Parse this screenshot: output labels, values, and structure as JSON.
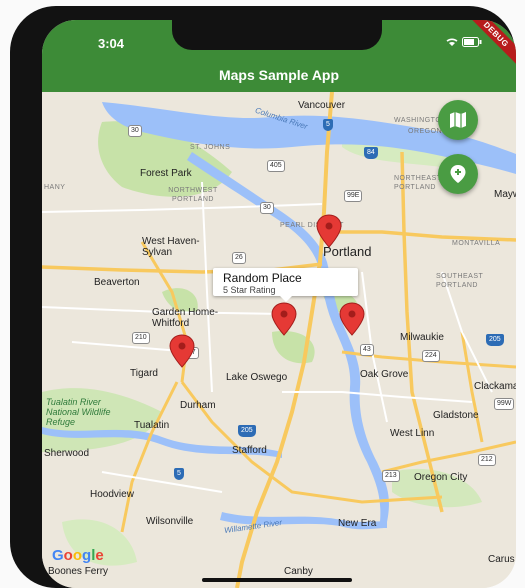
{
  "status_bar": {
    "time": "3:04",
    "icons": "wifi-battery",
    "debug_banner": "DEBUG"
  },
  "app_bar": {
    "title": "Maps Sample App"
  },
  "map": {
    "cities": [
      "Vancouver",
      "Portland",
      "Forest Park",
      "West Haven-Sylvan",
      "Beaverton",
      "Garden Home-Whitford",
      "Tigard",
      "Lake Oswego",
      "Oak Grove",
      "Milwaukie",
      "Durham",
      "Tualatin",
      "Stafford",
      "West Linn",
      "Gladstone",
      "Oregon City",
      "Hoodview",
      "Wilsonville",
      "New Era",
      "Canby",
      "Clackamas",
      "Maywood Park",
      "Carus",
      "Sherwood",
      "Boones Ferry"
    ],
    "districts": [
      "ST. JOHNS",
      "NORTHWEST PORTLAND",
      "PEARL DISTRICT",
      "NORTHEAST PORTLAND",
      "SOUTHEAST PORTLAND",
      "MONTAVILLA",
      "WASHINGTON",
      "OREGON",
      "HANY"
    ],
    "water_labels": [
      "Columbia River",
      "Willamette River"
    ],
    "green_labels": [
      "Tualatin River National Wildlife Refuge"
    ],
    "highway_shields": [
      "30",
      "5",
      "405",
      "30",
      "26",
      "84",
      "205",
      "217",
      "210",
      "99E",
      "224",
      "43",
      "212",
      "213",
      "205",
      "5",
      "99W"
    ],
    "attribution": "Google",
    "info_window": {
      "title": "Random Place",
      "snippet": "5 Star Rating"
    },
    "markers": [
      "marker-pearl-district",
      "marker-portland-south",
      "marker-milwaukie",
      "marker-tigard"
    ]
  },
  "fabs": [
    {
      "name": "map-type-button",
      "icon": "map-icon"
    },
    {
      "name": "add-marker-button",
      "icon": "add-location-icon"
    }
  ],
  "colors": {
    "app_bar": "#3d8b37",
    "fab": "#4a9c43",
    "marker": "#e53935",
    "water": "#9cc0f9",
    "park": "#c7e2a8"
  }
}
